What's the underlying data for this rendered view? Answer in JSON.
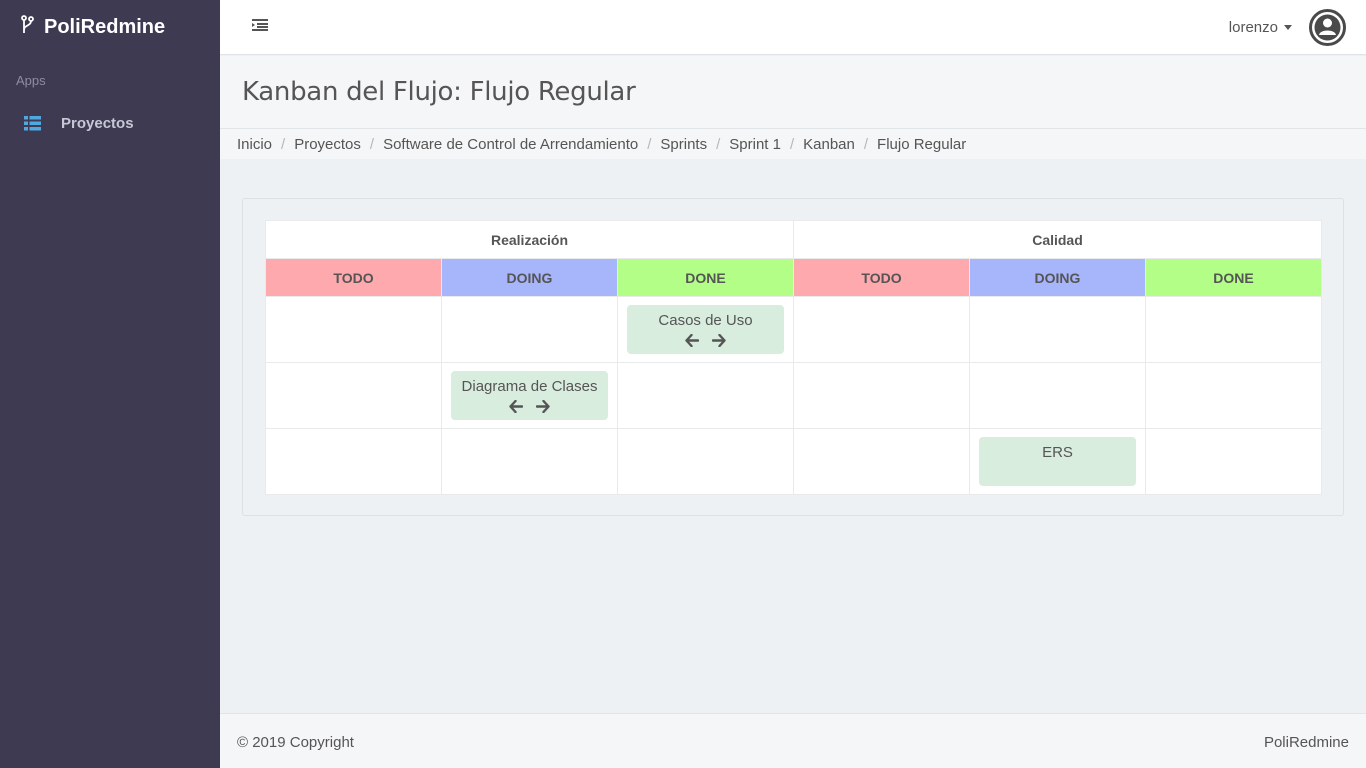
{
  "app": {
    "name": "PoliRedmine"
  },
  "sidebar": {
    "section_label": "Apps",
    "items": [
      {
        "label": "Proyectos",
        "icon": "list-icon"
      }
    ]
  },
  "topbar": {
    "user_name": "lorenzo"
  },
  "page": {
    "title": "Kanban del Flujo: Flujo Regular"
  },
  "breadcrumb": [
    "Inicio",
    "Proyectos",
    "Software de Control de Arrendamiento",
    "Sprints",
    "Sprint 1",
    "Kanban",
    "Flujo Regular"
  ],
  "kanban": {
    "groups": [
      {
        "name": "Realización",
        "columns": [
          "TODO",
          "DOING",
          "DONE"
        ]
      },
      {
        "name": "Calidad",
        "columns": [
          "TODO",
          "DOING",
          "DONE"
        ]
      }
    ],
    "column_colors": {
      "TODO": "#fda9ad",
      "DOING": "#a7b5fb",
      "DONE": "#b2fe86"
    },
    "rows": [
      {
        "task": "Casos de Uso",
        "column_index": 2,
        "arrows": true
      },
      {
        "task": "Diagrama de Clases",
        "column_index": 1,
        "arrows": true
      },
      {
        "task": "ERS",
        "column_index": 4,
        "arrows": false
      }
    ]
  },
  "footer": {
    "copyright": "© 2019 Copyright",
    "brand": "PoliRedmine"
  }
}
